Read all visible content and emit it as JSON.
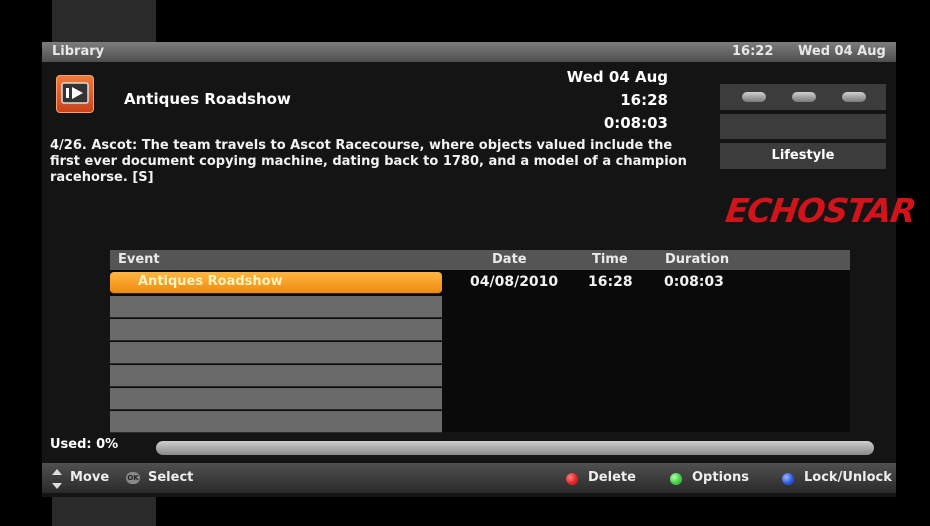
{
  "header": {
    "title": "Library",
    "clock": "16:22",
    "date": "Wed 04 Aug"
  },
  "programme": {
    "title": "Antiques Roadshow",
    "date": "Wed 04 Aug",
    "time": "16:28",
    "duration": "0:08:03",
    "description": "4/26. Ascot: The team travels to Ascot Racecourse, where objects valued include the first ever document copying machine, dating back to 1780, and a model of a champion racehorse. [S]",
    "genre": "Lifestyle",
    "icon": "recording-play-icon"
  },
  "logo": "ECHOSTAR",
  "table": {
    "columns": {
      "event": "Event",
      "date": "Date",
      "time": "Time",
      "duration": "Duration"
    },
    "rows": [
      {
        "event": "Antiques Roadshow",
        "date": "04/08/2010",
        "time": "16:28",
        "duration": "0:08:03"
      }
    ]
  },
  "usage": {
    "label": "Used: 0%",
    "fraction": 0.0
  },
  "footer": {
    "move": "Move",
    "select": "Select",
    "delete": "Delete",
    "options": "Options",
    "lock": "Lock/Unlock"
  },
  "colors": {
    "accent": "#f5a020",
    "red": "#e02020",
    "green": "#3cc83c",
    "blue": "#2850e0",
    "logo": "#d1141c"
  }
}
